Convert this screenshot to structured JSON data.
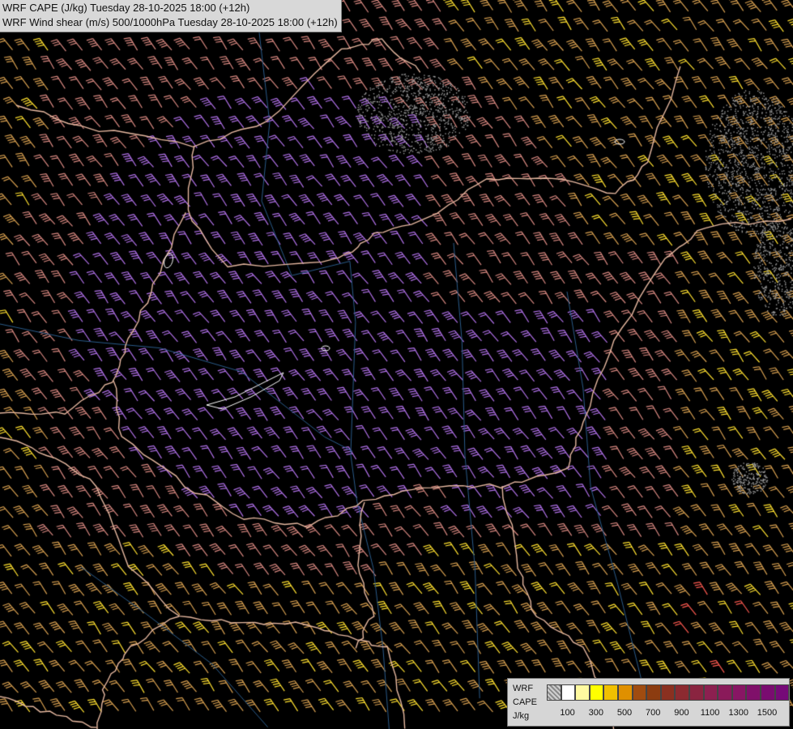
{
  "titles": {
    "line1": "WRF CAPE (J/kg) Tuesday 28-10-2025 18:00 (+12h)",
    "line2": "WRF Wind shear (m/s) 500/1000hPa Tuesday 28-10-2025 18:00 (+12h)"
  },
  "legend": {
    "label_line1": "WRF",
    "label_line2": "CAPE",
    "label_line3": "J/kg",
    "swatch_colors": [
      "hatched",
      "#ffffff",
      "#fffaa0",
      "#ffff00",
      "#f0c000",
      "#e09000",
      "#a04c10",
      "#8c3c10",
      "#8a3020",
      "#8c2a30",
      "#8a2440",
      "#8c2050",
      "#8a1a5a",
      "#881664",
      "#80106a",
      "#7a0c70",
      "#760a78"
    ],
    "ticks": [
      "100",
      "300",
      "500",
      "700",
      "900",
      "1100",
      "1300",
      "1500"
    ]
  },
  "map": {
    "background": "#000000",
    "border_color": "#e6b8a0",
    "river_color": "#2a5b8a",
    "barb_colors": {
      "weak_shear": "#b070e8",
      "moderate_shear": "#d88880",
      "strong_shear": "#d8a050",
      "very_strong_shear": "#ffe030",
      "extreme_shear": "#ff5a50"
    }
  }
}
